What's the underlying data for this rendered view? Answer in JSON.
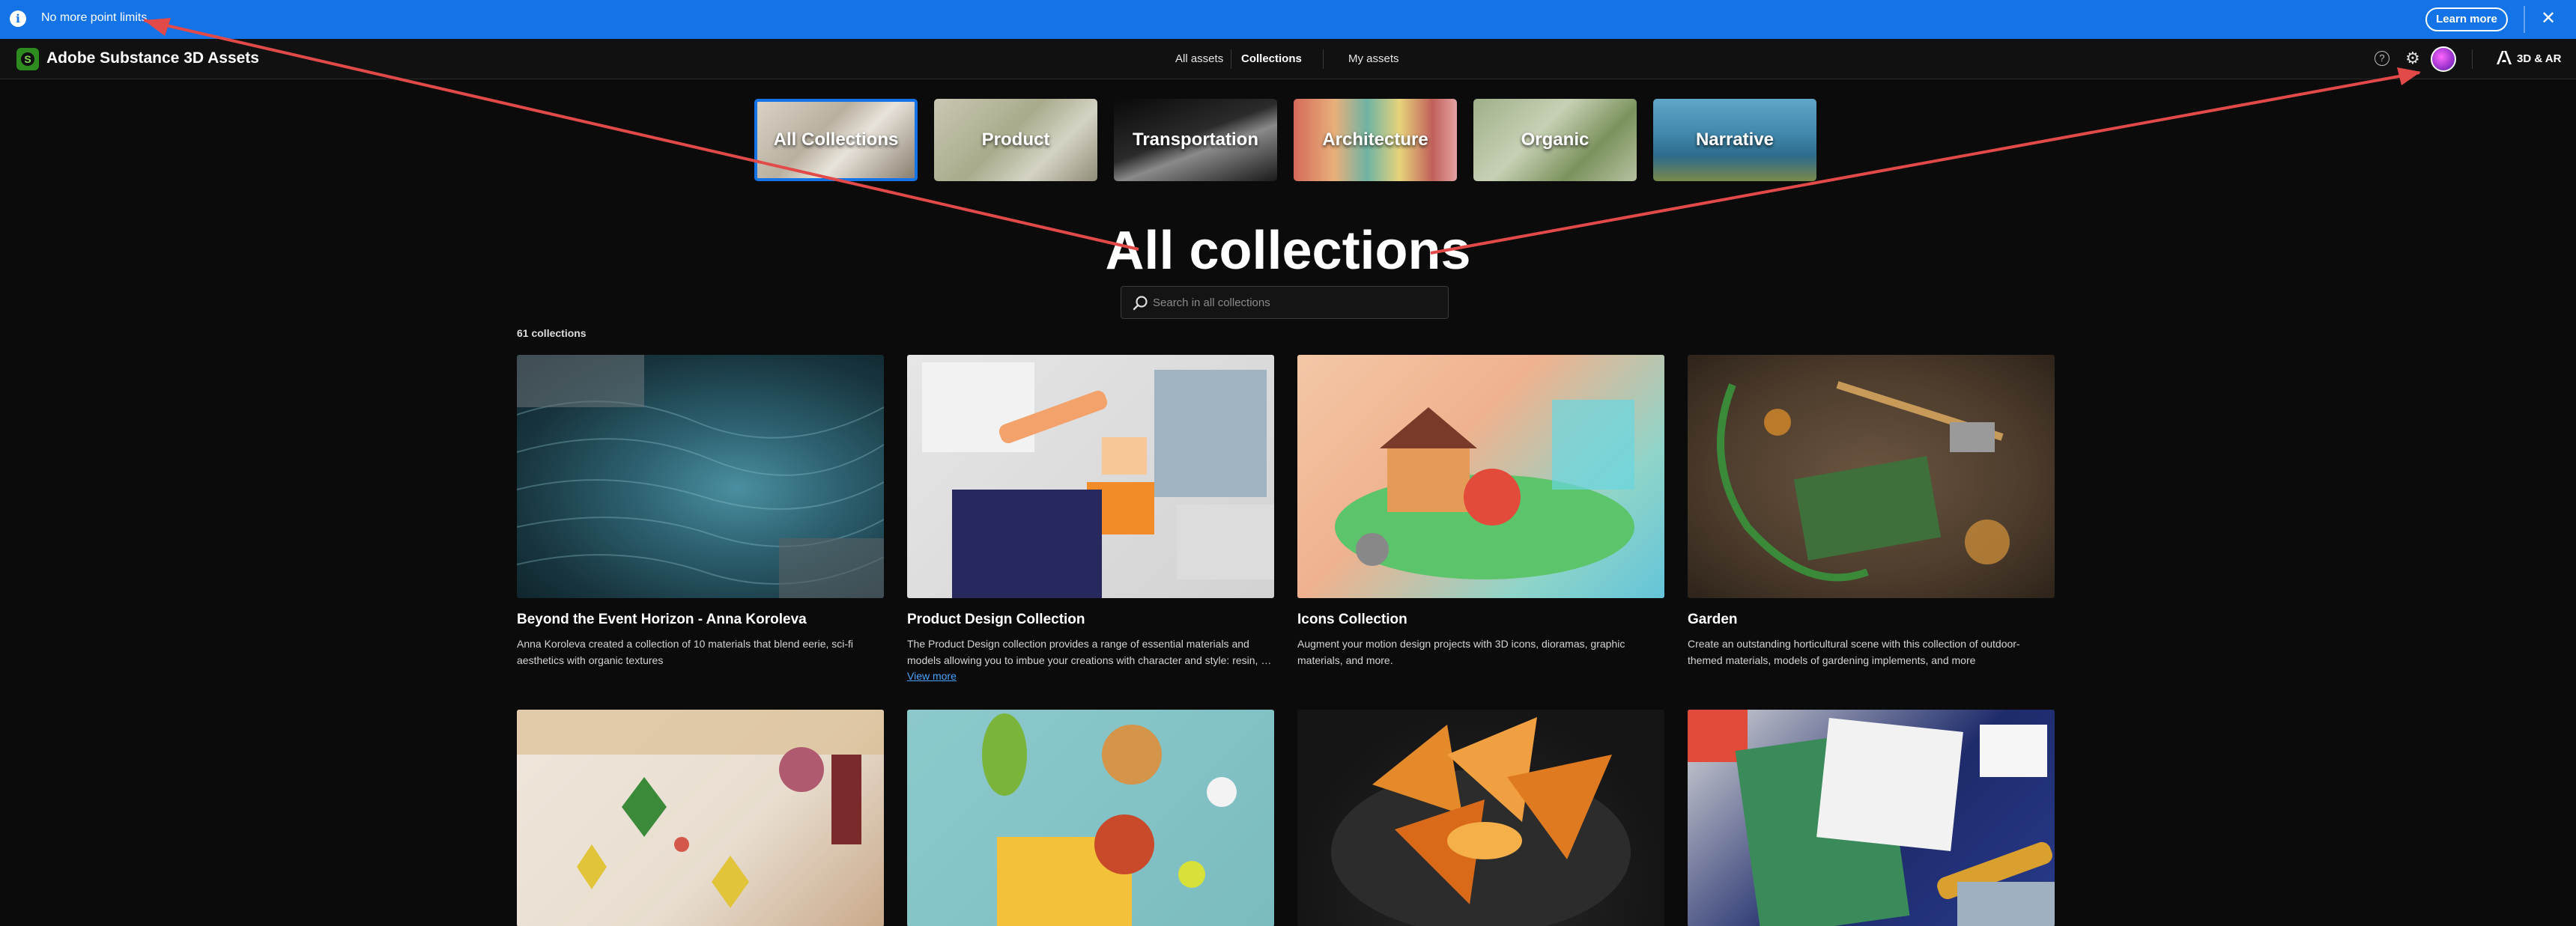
{
  "banner": {
    "text": "No more point limits",
    "learn_more": "Learn more",
    "close": "✕",
    "info": "i"
  },
  "header": {
    "app_title": "Adobe Substance 3D Assets",
    "logo_letter": "S",
    "nav": [
      "All assets",
      "Collections",
      "My assets"
    ],
    "help": "?",
    "gear": "⚙",
    "ar_label": "3D & AR"
  },
  "categories": [
    "All Collections",
    "Product",
    "Transportation",
    "Architecture",
    "Organic",
    "Narrative"
  ],
  "page_title": "All collections",
  "search": {
    "placeholder": "Search in all collections"
  },
  "count_text": "61 collections",
  "cards": [
    {
      "title": "Beyond the Event Horizon - Anna Koroleva",
      "desc": "Anna Koroleva created a collection of 10 materials that blend eerie, sci-fi aesthetics with organic textures"
    },
    {
      "title": "Product Design Collection",
      "desc": "The Product Design collection provides a range of essential materials and models allowing you to imbue your creations with character and style: resin, …",
      "view_more": "View more"
    },
    {
      "title": "Icons Collection",
      "desc": "Augment your motion design projects with 3D icons, dioramas, graphic materials, and more."
    },
    {
      "title": "Garden",
      "desc": "Create an outstanding horticultural scene with this collection of outdoor-themed materials, models of gardening implements, and more"
    }
  ],
  "colors": {
    "accent": "#1473e6",
    "background": "#0b0b0b",
    "annotation_arrow": "#e24a4a",
    "logo": "#2d8b1f"
  }
}
